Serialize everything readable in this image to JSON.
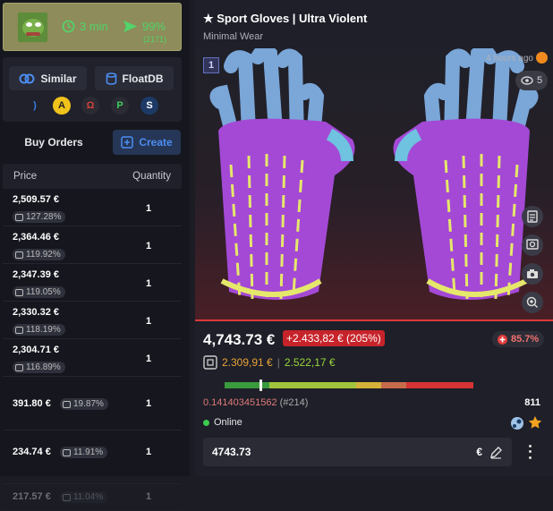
{
  "seller": {
    "time": "3 min",
    "rate": "99%",
    "count": "(2171)"
  },
  "tools": {
    "similar": "Similar",
    "floatdb": "FloatDB"
  },
  "orders": {
    "label": "Buy Orders",
    "create": "Create"
  },
  "table": {
    "price_header": "Price",
    "qty_header": "Quantity",
    "rows": [
      {
        "price": "2,509.57 €",
        "pct": "127.28%",
        "qty": "1"
      },
      {
        "price": "2,364.46 €",
        "pct": "119.92%",
        "qty": "1"
      },
      {
        "price": "2,347.39 €",
        "pct": "119.05%",
        "qty": "1"
      },
      {
        "price": "2,330.32 €",
        "pct": "118.19%",
        "qty": "1"
      },
      {
        "price": "2,304.71 €",
        "pct": "116.89%",
        "qty": "1"
      },
      {
        "price": "391.80 €",
        "pct": "19.87%",
        "qty": "1"
      },
      {
        "price": "234.74 €",
        "pct": "11.91%",
        "qty": "1"
      },
      {
        "price": "217.57 €",
        "pct": "11.04%",
        "qty": "1"
      }
    ]
  },
  "item": {
    "title": "★ Sport Gloves | Ultra Violent",
    "wear": "Minimal Wear",
    "rank": "1",
    "ago": "4 hours ago",
    "views": "5",
    "price": "4,743.73 €",
    "diff": "+2.433,82 € (205%)",
    "rate": "85.7%",
    "sub_low": "2.309,91 €",
    "sub_sep": "|",
    "sub_high": "2.522,17 €",
    "float_value": "0.141403451562",
    "float_rank": "(#214)",
    "pattern": "811",
    "status": "Online",
    "input_value": "4743.73",
    "currency": "€",
    "wear_level": 0.141
  },
  "colors": {
    "accent": "#2b72d6",
    "green": "#52d46a",
    "red": "#c7232a"
  }
}
